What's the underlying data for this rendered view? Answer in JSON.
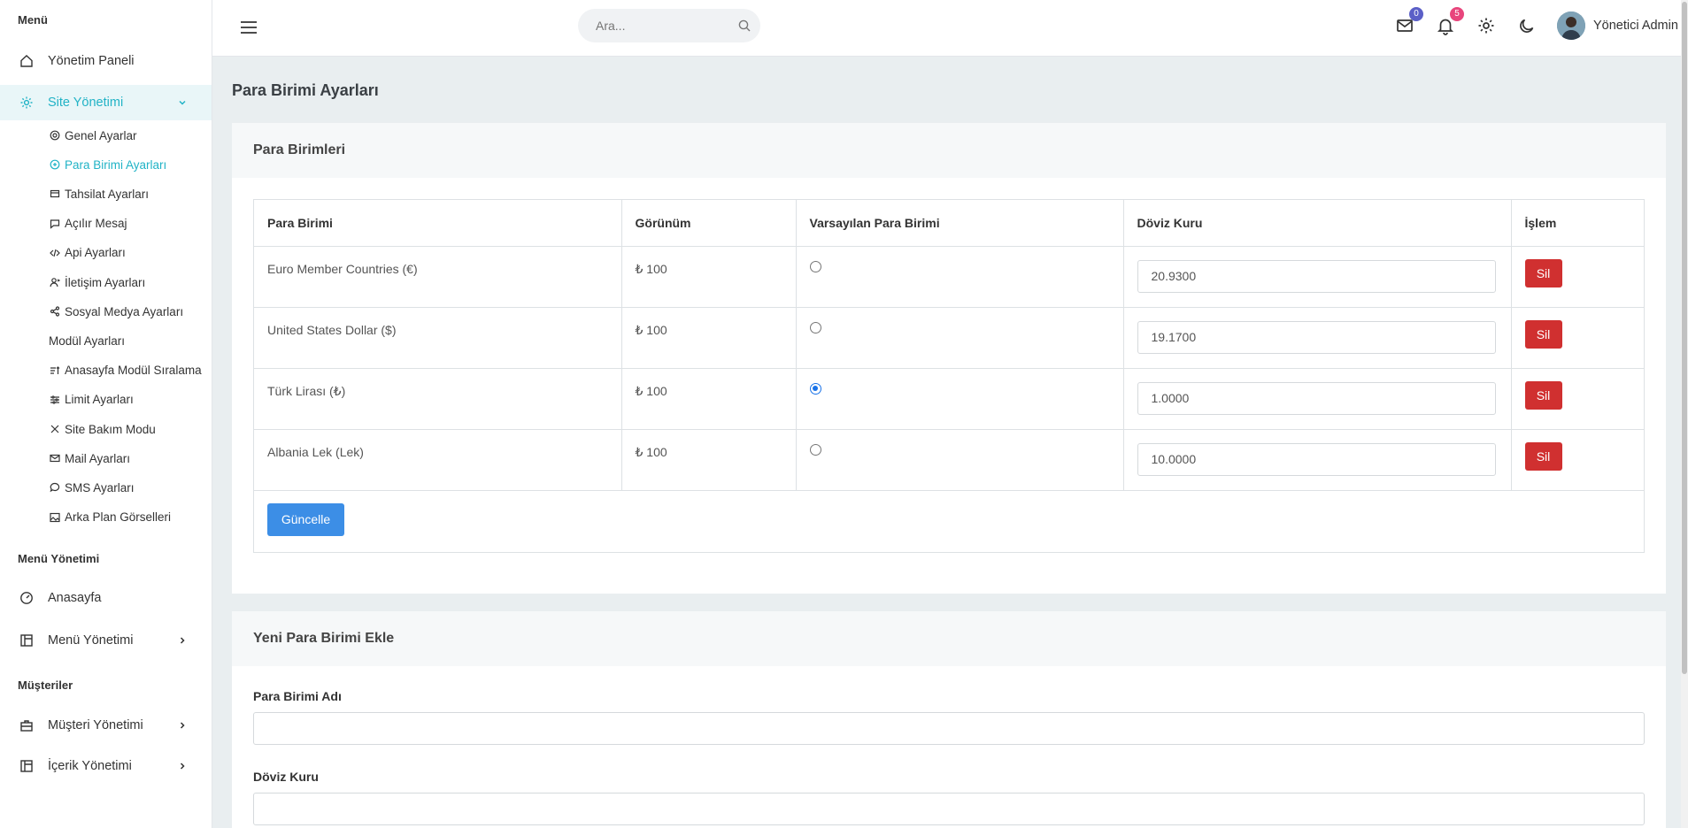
{
  "sidebar": {
    "section_menu": "Menü",
    "dashboard": "Yönetim Paneli",
    "site_management": "Site Yönetimi",
    "sub_items": [
      {
        "label": "Genel Ayarlar",
        "icon": "gear-small-icon"
      },
      {
        "label": "Para Birimi Ayarları",
        "icon": "currency-icon",
        "active": true
      },
      {
        "label": "Tahsilat Ayarları",
        "icon": "wallet-icon"
      },
      {
        "label": "Açılır Mesaj",
        "icon": "message-icon"
      },
      {
        "label": "Api Ayarları",
        "icon": "code-icon"
      },
      {
        "label": "İletişim Ayarları",
        "icon": "contact-icon"
      },
      {
        "label": "Sosyal Medya Ayarları",
        "icon": "share-icon"
      },
      {
        "label": "Modül Ayarları",
        "icon": ""
      },
      {
        "label": "Anasayfa Modül Sıralama",
        "icon": "sort-icon"
      },
      {
        "label": "Limit Ayarları",
        "icon": "sliders-icon"
      },
      {
        "label": "Site Bakım Modu",
        "icon": "tools-icon"
      },
      {
        "label": "Mail Ayarları",
        "icon": "mail-icon"
      },
      {
        "label": "SMS Ayarları",
        "icon": "chat-icon"
      },
      {
        "label": "Arka Plan Görselleri",
        "icon": "image-icon"
      }
    ],
    "section_menu_management": "Menü Yönetimi",
    "home": "Anasayfa",
    "menu_management": "Menü Yönetimi",
    "section_customers": "Müşteriler",
    "customer_management": "Müşteri Yönetimi",
    "content_management": "İçerik Yönetimi"
  },
  "topbar": {
    "search_placeholder": "Ara...",
    "mail_count": "0",
    "notification_count": "5",
    "user_name": "Yönetici Admin"
  },
  "page": {
    "title": "Para Birimi Ayarları"
  },
  "currencies_card": {
    "title": "Para Birimleri",
    "columns": [
      "Para Birimi",
      "Görünüm",
      "Varsayılan Para Birimi",
      "Döviz Kuru",
      "İşlem"
    ],
    "rows": [
      {
        "name": "Euro Member Countries (€)",
        "display": "₺ 100",
        "default": false,
        "rate": "20.9300",
        "action": "Sil"
      },
      {
        "name": "United States Dollar ($)",
        "display": "₺ 100",
        "default": false,
        "rate": "19.1700",
        "action": "Sil"
      },
      {
        "name": "Türk Lirası (₺)",
        "display": "₺ 100",
        "default": true,
        "rate": "1.0000",
        "action": "Sil"
      },
      {
        "name": "Albania Lek (Lek)",
        "display": "₺ 100",
        "default": false,
        "rate": "10.0000",
        "action": "Sil"
      }
    ],
    "update_button": "Güncelle"
  },
  "new_currency_card": {
    "title": "Yeni Para Birimi Ekle",
    "name_label": "Para Birimi Adı",
    "rate_label": "Döviz Kuru"
  },
  "colors": {
    "accent": "#21b3c6",
    "danger": "#d03030",
    "primary": "#3c8ee6",
    "mail_badge": "#5b5fc7",
    "notification_badge": "#e8457c"
  }
}
